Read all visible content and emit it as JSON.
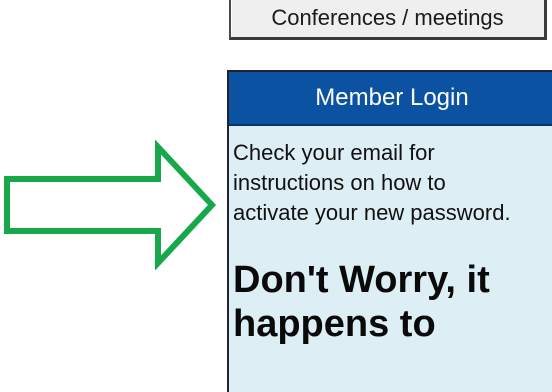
{
  "nav": {
    "conferences_label": "Conferences / meetings"
  },
  "login": {
    "header": "Member Login",
    "message": "Check your email for instructions on how to activate your new password.",
    "heading_line1": "Don't Worry, it",
    "heading_line2": "happens to"
  },
  "annotation": {
    "arrow_color": "#17a84b",
    "arrow_icon": "arrow-right-outline-icon"
  },
  "colors": {
    "header_bg": "#0b52a2",
    "panel_bg": "#ddeef5",
    "button_bg": "#efefef"
  }
}
